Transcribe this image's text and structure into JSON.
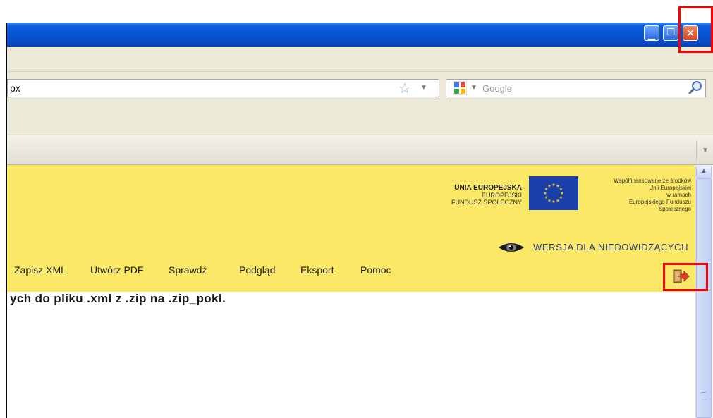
{
  "window": {
    "controls": {
      "minimize_icon": "minimize-icon",
      "maximize_icon": "maximize-icon",
      "close_icon": "close-icon"
    }
  },
  "browser": {
    "address_bar": {
      "value": "px"
    },
    "search_bar": {
      "placeholder": "Google"
    }
  },
  "page": {
    "eu_block": {
      "line1": "UNIA EUROPEJSKA",
      "line2": "EUROPEJSKI",
      "line3": "FUNDUSZ SPOŁECZNY"
    },
    "cofinancing": {
      "line1": "Współfinansowane ze środków",
      "line2": "Unii Europejskiej",
      "line3": "w ramach",
      "line4": "Europejskiego Funduszu",
      "line5": "Społecznego"
    },
    "low_vision_link": "WERSJA DLA NIEDOWIDZĄCYCH",
    "nav": [
      {
        "label": "Zapisz XML"
      },
      {
        "label": "Utwórz PDF"
      },
      {
        "label": "Sprawdź"
      },
      {
        "label": "Podgląd"
      },
      {
        "label": "Eksport"
      },
      {
        "label": "Pomoc"
      }
    ],
    "message": "ych do pliku .xml z .zip na .zip_pokl."
  },
  "colors": {
    "titlebar": "#0852d0",
    "header_bg": "#fbe866",
    "highlight": "#ff0000",
    "eu_flag": "#1b3fa8",
    "link": "#2a3a8a"
  }
}
